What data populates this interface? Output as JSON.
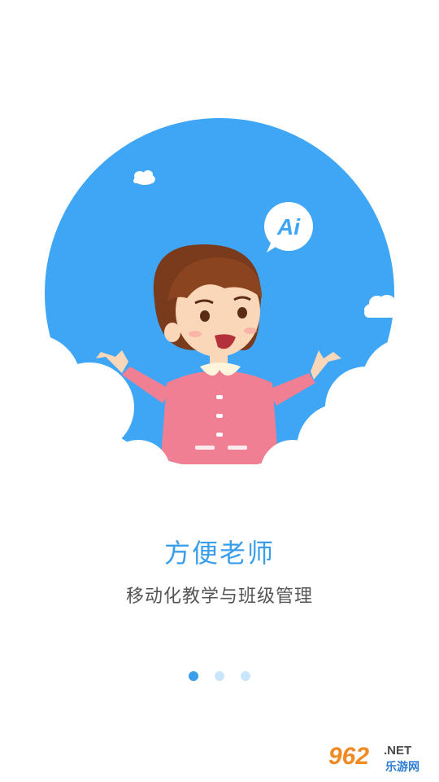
{
  "onboarding": {
    "title": "方便老师",
    "subtitle": "移动化教学与班级管理",
    "page_indicator": {
      "total": 3,
      "active_index": 0
    },
    "speech_bubble_text": "Ai"
  },
  "watermark": {
    "number": "962",
    "suffix": ".NET",
    "text": "乐游网"
  },
  "colors": {
    "accent": "#3a9eea",
    "sky": "#3ea6f5",
    "dot_inactive": "#c9e6fb",
    "subtitle": "#555555"
  }
}
